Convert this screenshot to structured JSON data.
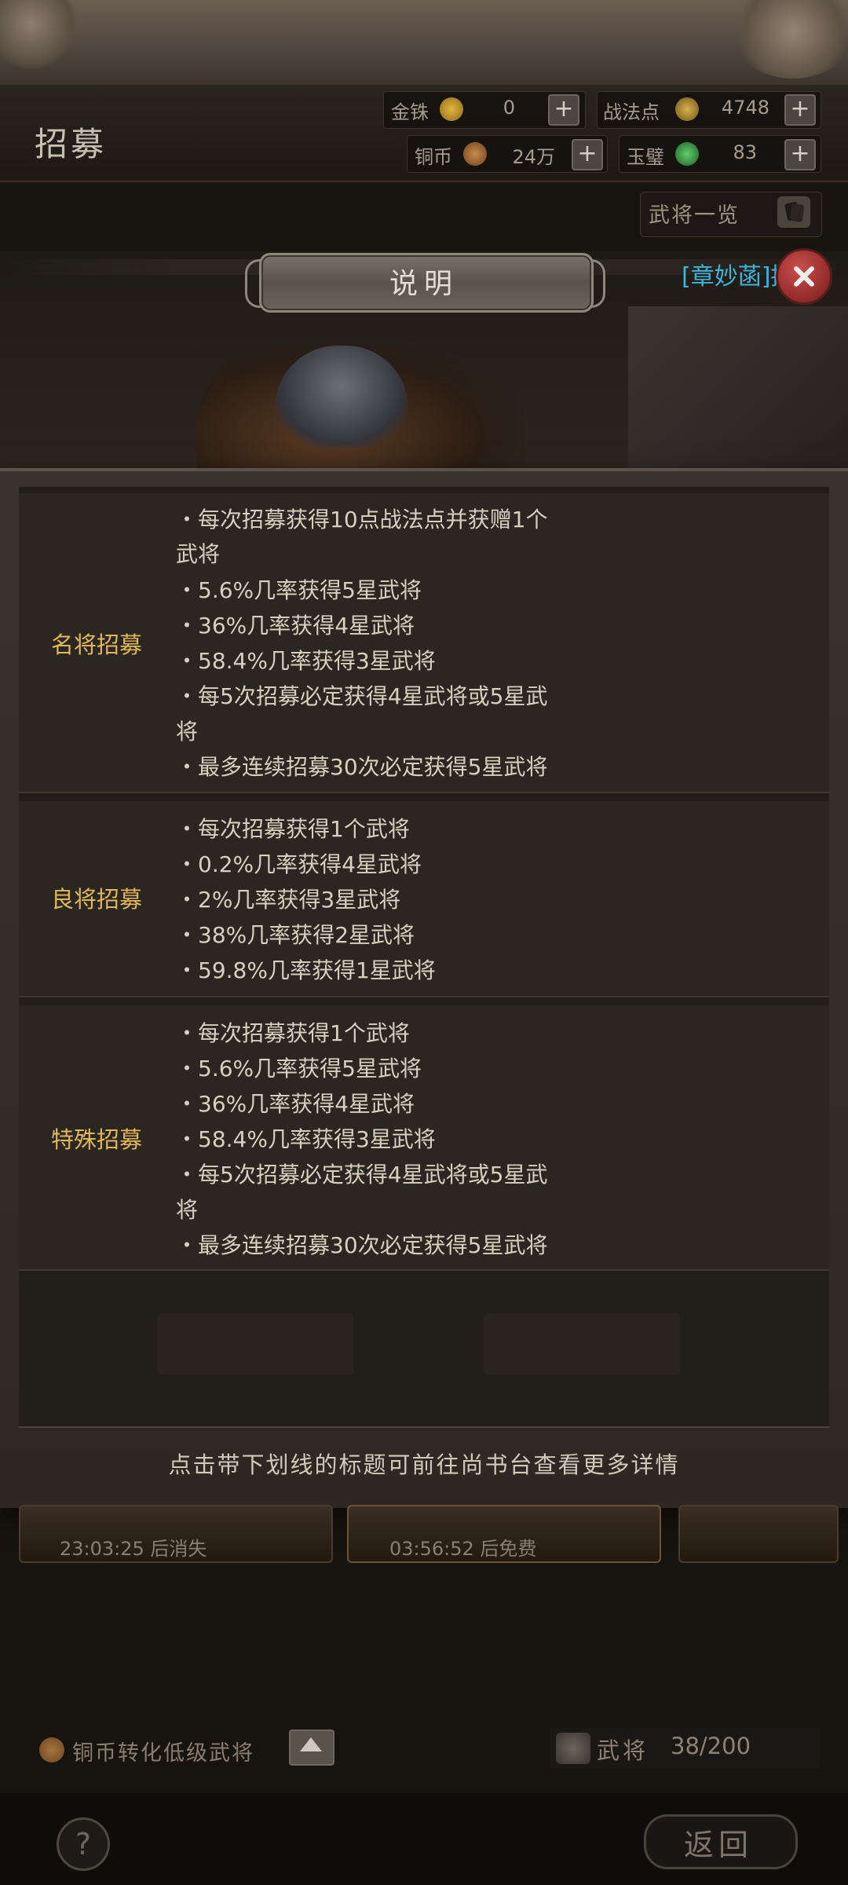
{
  "header": {
    "title": "招募",
    "resources": {
      "gold_pearl": {
        "label": "金铢",
        "value": "0",
        "icon": "gold-pearl-coin-icon",
        "color": "#c79a2a"
      },
      "tactic_points": {
        "label": "战法点",
        "value": "4748",
        "icon": "tactic-point-icon",
        "color": "#b9902e"
      },
      "copper": {
        "label": "铜币",
        "value": "24万",
        "icon": "copper-coin-icon",
        "color": "#b37334"
      },
      "jade": {
        "label": "玉璧",
        "value": "83",
        "icon": "jade-disc-icon",
        "color": "#3f9b4a"
      }
    },
    "plus_label": "+",
    "hero_list_label": "武将一览"
  },
  "dialog": {
    "title": "说明",
    "notice_link": "[章妙菡]招",
    "sections": [
      {
        "label": "名将招募",
        "lines": [
          "・每次招募获得10点战法点并获赠1个",
          "武将",
          "・5.6%几率获得5星武将",
          "・36%几率获得4星武将",
          "・58.4%几率获得3星武将",
          "・每5次招募必定获得4星武将或5星武",
          "将",
          "・最多连续招募30次必定获得5星武将"
        ]
      },
      {
        "label": "良将招募",
        "lines": [
          "・每次招募获得1个武将",
          "・0.2%几率获得4星武将",
          "・2%几率获得3星武将",
          "・38%几率获得2星武将",
          "・59.8%几率获得1星武将"
        ]
      },
      {
        "label": "特殊招募",
        "lines": [
          "・每次招募获得1个武将",
          "・5.6%几率获得5星武将",
          "・36%几率获得4星武将",
          "・58.4%几率获得3星武将",
          "・每5次招募必定获得4星武将或5星武",
          "将",
          "・最多连续招募30次必定获得5星武将"
        ]
      }
    ],
    "footer_note": "点击带下划线的标题可前往尚书台查看更多详情"
  },
  "bottom": {
    "card_timers": [
      "23:03:25 后消失",
      "03:56:52 后免费"
    ],
    "convert_label": "铜币转化低级武将",
    "hero_count_label": "武将",
    "hero_count_value": "38/200",
    "help_label": "?",
    "back_label": "返回"
  }
}
